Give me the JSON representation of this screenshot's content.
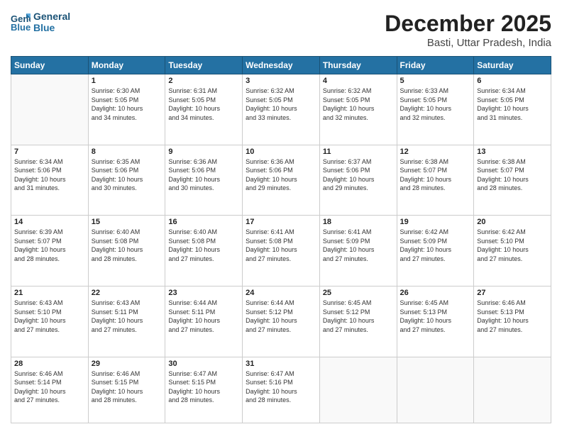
{
  "logo": {
    "line1": "General",
    "line2": "Blue"
  },
  "title": "December 2025",
  "subtitle": "Basti, Uttar Pradesh, India",
  "days_header": [
    "Sunday",
    "Monday",
    "Tuesday",
    "Wednesday",
    "Thursday",
    "Friday",
    "Saturday"
  ],
  "weeks": [
    [
      {
        "day": "",
        "info": ""
      },
      {
        "day": "1",
        "info": "Sunrise: 6:30 AM\nSunset: 5:05 PM\nDaylight: 10 hours\nand 34 minutes."
      },
      {
        "day": "2",
        "info": "Sunrise: 6:31 AM\nSunset: 5:05 PM\nDaylight: 10 hours\nand 34 minutes."
      },
      {
        "day": "3",
        "info": "Sunrise: 6:32 AM\nSunset: 5:05 PM\nDaylight: 10 hours\nand 33 minutes."
      },
      {
        "day": "4",
        "info": "Sunrise: 6:32 AM\nSunset: 5:05 PM\nDaylight: 10 hours\nand 32 minutes."
      },
      {
        "day": "5",
        "info": "Sunrise: 6:33 AM\nSunset: 5:05 PM\nDaylight: 10 hours\nand 32 minutes."
      },
      {
        "day": "6",
        "info": "Sunrise: 6:34 AM\nSunset: 5:05 PM\nDaylight: 10 hours\nand 31 minutes."
      }
    ],
    [
      {
        "day": "7",
        "info": "Sunrise: 6:34 AM\nSunset: 5:06 PM\nDaylight: 10 hours\nand 31 minutes."
      },
      {
        "day": "8",
        "info": "Sunrise: 6:35 AM\nSunset: 5:06 PM\nDaylight: 10 hours\nand 30 minutes."
      },
      {
        "day": "9",
        "info": "Sunrise: 6:36 AM\nSunset: 5:06 PM\nDaylight: 10 hours\nand 30 minutes."
      },
      {
        "day": "10",
        "info": "Sunrise: 6:36 AM\nSunset: 5:06 PM\nDaylight: 10 hours\nand 29 minutes."
      },
      {
        "day": "11",
        "info": "Sunrise: 6:37 AM\nSunset: 5:06 PM\nDaylight: 10 hours\nand 29 minutes."
      },
      {
        "day": "12",
        "info": "Sunrise: 6:38 AM\nSunset: 5:07 PM\nDaylight: 10 hours\nand 28 minutes."
      },
      {
        "day": "13",
        "info": "Sunrise: 6:38 AM\nSunset: 5:07 PM\nDaylight: 10 hours\nand 28 minutes."
      }
    ],
    [
      {
        "day": "14",
        "info": "Sunrise: 6:39 AM\nSunset: 5:07 PM\nDaylight: 10 hours\nand 28 minutes."
      },
      {
        "day": "15",
        "info": "Sunrise: 6:40 AM\nSunset: 5:08 PM\nDaylight: 10 hours\nand 28 minutes."
      },
      {
        "day": "16",
        "info": "Sunrise: 6:40 AM\nSunset: 5:08 PM\nDaylight: 10 hours\nand 27 minutes."
      },
      {
        "day": "17",
        "info": "Sunrise: 6:41 AM\nSunset: 5:08 PM\nDaylight: 10 hours\nand 27 minutes."
      },
      {
        "day": "18",
        "info": "Sunrise: 6:41 AM\nSunset: 5:09 PM\nDaylight: 10 hours\nand 27 minutes."
      },
      {
        "day": "19",
        "info": "Sunrise: 6:42 AM\nSunset: 5:09 PM\nDaylight: 10 hours\nand 27 minutes."
      },
      {
        "day": "20",
        "info": "Sunrise: 6:42 AM\nSunset: 5:10 PM\nDaylight: 10 hours\nand 27 minutes."
      }
    ],
    [
      {
        "day": "21",
        "info": "Sunrise: 6:43 AM\nSunset: 5:10 PM\nDaylight: 10 hours\nand 27 minutes."
      },
      {
        "day": "22",
        "info": "Sunrise: 6:43 AM\nSunset: 5:11 PM\nDaylight: 10 hours\nand 27 minutes."
      },
      {
        "day": "23",
        "info": "Sunrise: 6:44 AM\nSunset: 5:11 PM\nDaylight: 10 hours\nand 27 minutes."
      },
      {
        "day": "24",
        "info": "Sunrise: 6:44 AM\nSunset: 5:12 PM\nDaylight: 10 hours\nand 27 minutes."
      },
      {
        "day": "25",
        "info": "Sunrise: 6:45 AM\nSunset: 5:12 PM\nDaylight: 10 hours\nand 27 minutes."
      },
      {
        "day": "26",
        "info": "Sunrise: 6:45 AM\nSunset: 5:13 PM\nDaylight: 10 hours\nand 27 minutes."
      },
      {
        "day": "27",
        "info": "Sunrise: 6:46 AM\nSunset: 5:13 PM\nDaylight: 10 hours\nand 27 minutes."
      }
    ],
    [
      {
        "day": "28",
        "info": "Sunrise: 6:46 AM\nSunset: 5:14 PM\nDaylight: 10 hours\nand 27 minutes."
      },
      {
        "day": "29",
        "info": "Sunrise: 6:46 AM\nSunset: 5:15 PM\nDaylight: 10 hours\nand 28 minutes."
      },
      {
        "day": "30",
        "info": "Sunrise: 6:47 AM\nSunset: 5:15 PM\nDaylight: 10 hours\nand 28 minutes."
      },
      {
        "day": "31",
        "info": "Sunrise: 6:47 AM\nSunset: 5:16 PM\nDaylight: 10 hours\nand 28 minutes."
      },
      {
        "day": "",
        "info": ""
      },
      {
        "day": "",
        "info": ""
      },
      {
        "day": "",
        "info": ""
      }
    ]
  ]
}
